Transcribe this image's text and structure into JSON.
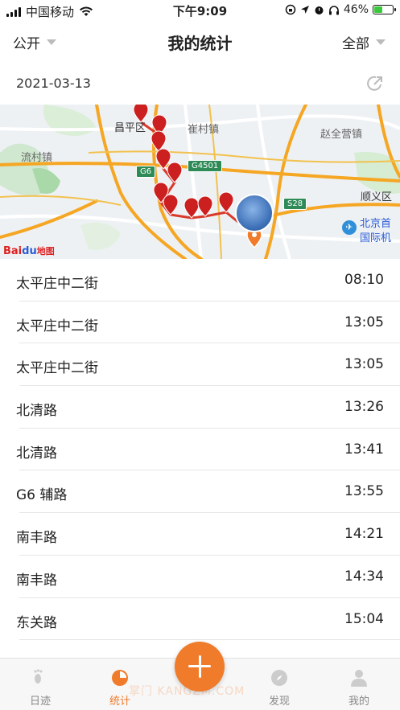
{
  "status_bar": {
    "carrier": "中国移动",
    "time": "下午9:09",
    "battery": "46%",
    "battery_level": 0.46
  },
  "nav": {
    "left_label": "公开",
    "title": "我的统计",
    "right_label": "全部"
  },
  "date": "2021-03-13",
  "map": {
    "labels": {
      "changping": "昌平区",
      "cuicun": "崔村镇",
      "liucun": "流村镇",
      "zhaoquanying": "赵全营镇",
      "shunyi": "顺义区",
      "airport_line1": "北京首",
      "airport_line2": "国际机"
    },
    "road_tags": {
      "g6": "G6",
      "g4501": "G4501",
      "s28": "S28"
    },
    "logo_bai": "Bai",
    "logo_du": "du",
    "logo_map": "地图"
  },
  "locations": [
    {
      "name": "太平庄中二街",
      "time": "08:10"
    },
    {
      "name": "太平庄中二街",
      "time": "13:05"
    },
    {
      "name": "太平庄中二街",
      "time": "13:05"
    },
    {
      "name": "北清路",
      "time": "13:26"
    },
    {
      "name": "北清路",
      "time": "13:41"
    },
    {
      "name": "G6 辅路",
      "time": "13:55"
    },
    {
      "name": "南丰路",
      "time": "14:21"
    },
    {
      "name": "南丰路",
      "time": "14:34"
    },
    {
      "name": "东关路",
      "time": "15:04"
    }
  ],
  "tabbar": {
    "tabs": [
      {
        "label": "日迹",
        "icon": "footprint-icon"
      },
      {
        "label": "统计",
        "icon": "pie-chart-icon"
      },
      {
        "label": "发现",
        "icon": "compass-icon"
      },
      {
        "label": "我的",
        "icon": "person-icon"
      }
    ],
    "active_tab": "统计",
    "watermark": "掌门 KANGZM.COM"
  },
  "colors": {
    "accent": "#f07b2a",
    "route": "#d93a2b",
    "marker": "#cc1f1f"
  }
}
